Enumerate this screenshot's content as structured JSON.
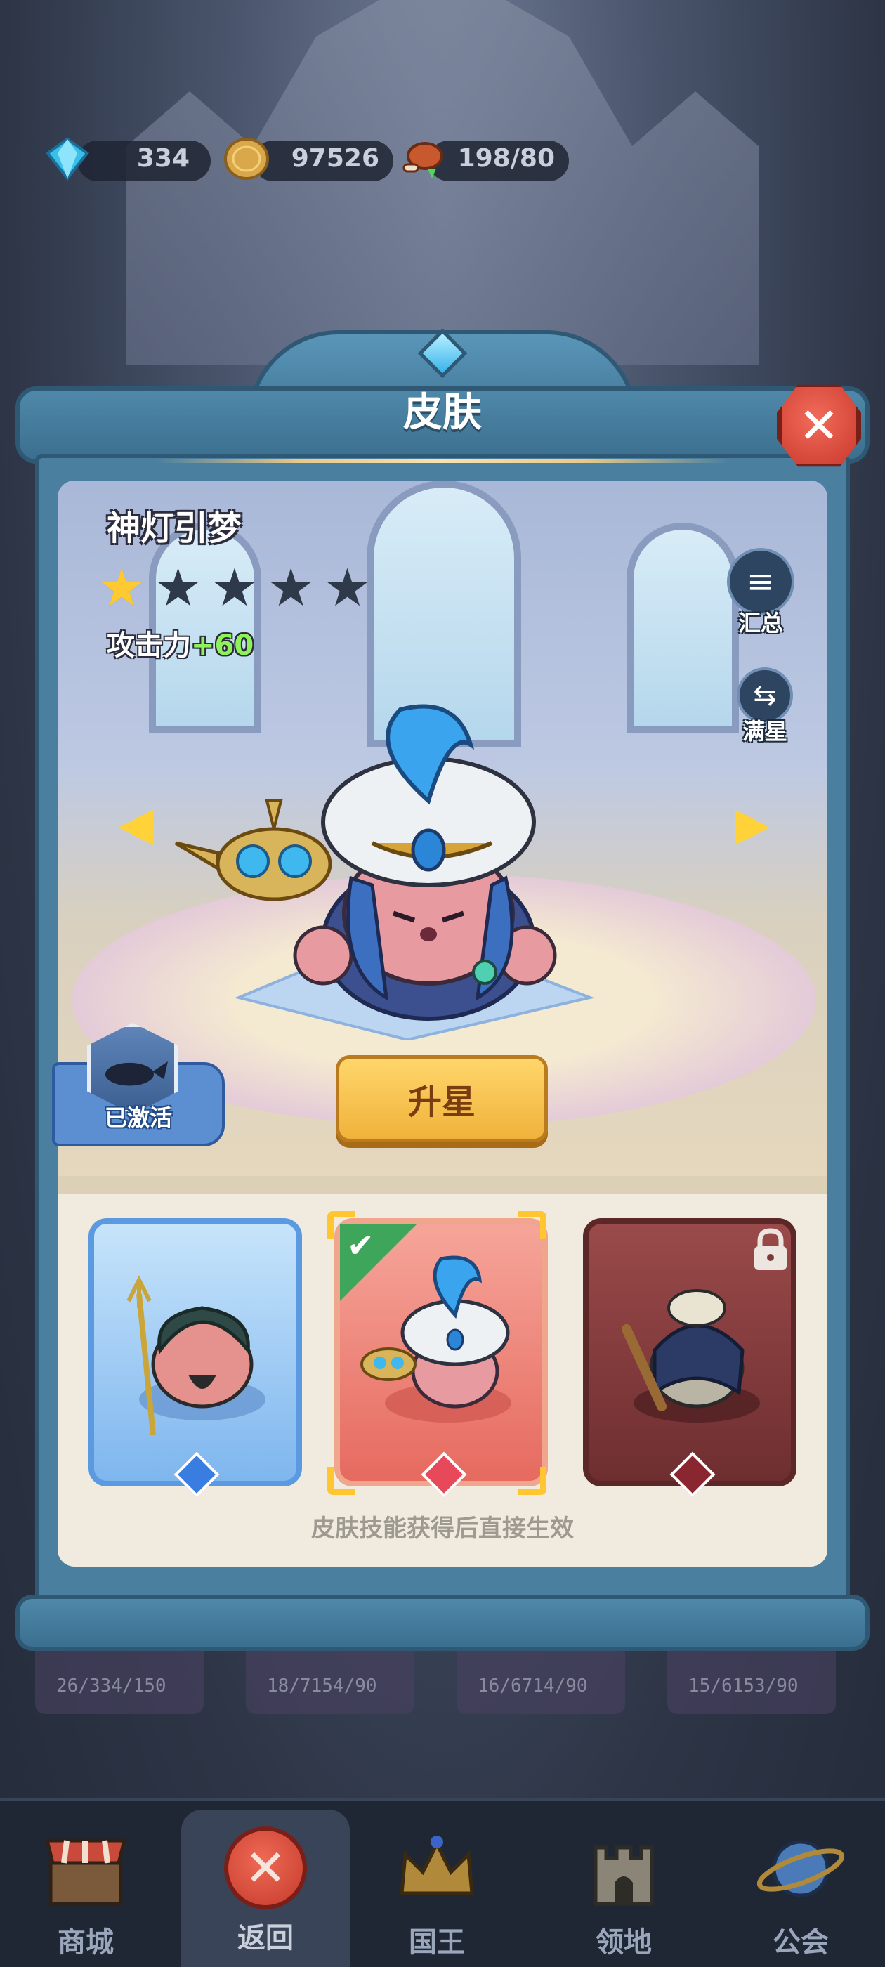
{
  "resources": [
    {
      "icon": "diamond-icon",
      "value": "334"
    },
    {
      "icon": "gold-coin-icon",
      "value": "97526"
    },
    {
      "icon": "meat-icon",
      "value": "198/80"
    }
  ],
  "popup": {
    "title": "皮肤",
    "close_icon": "close-icon"
  },
  "skin": {
    "name": "神灯引梦",
    "stars_total": 5,
    "stars_filled": 1,
    "attack_label": "攻击力",
    "attack_bonus": "+60"
  },
  "side_buttons": {
    "summary_label": "汇总",
    "max_star_label": "满星"
  },
  "activated_label": "已激活",
  "upgrade_button": "升星",
  "cards": [
    {
      "name": "trident-hero-card",
      "state": "unlocked"
    },
    {
      "name": "lamp-hero-card",
      "state": "selected"
    },
    {
      "name": "chef-hero-card",
      "state": "locked"
    }
  ],
  "card_note": "皮肤技能获得后直接生效",
  "background_board": [
    "26/334/150",
    "18/7154/90",
    "16/6714/90",
    "15/6153/90"
  ],
  "nav": [
    {
      "label": "商城",
      "icon": "shop-icon"
    },
    {
      "label": "返回",
      "icon": "close-icon"
    },
    {
      "label": "国王",
      "icon": "crown-icon"
    },
    {
      "label": "领地",
      "icon": "castle-icon"
    },
    {
      "label": "公会",
      "icon": "planet-icon"
    }
  ],
  "colors": {
    "frame": "#4a7f9f",
    "upgrade_button": "#f0b23b",
    "star_on": "#ffc931",
    "attack_bonus": "#8ff25b"
  }
}
